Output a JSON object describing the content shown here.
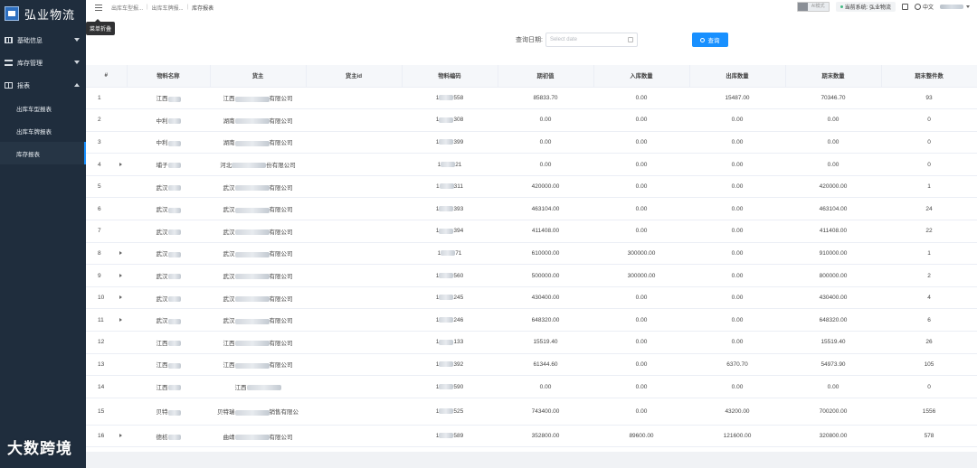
{
  "sidebar": {
    "logo_text": "弘业物流",
    "menu": [
      {
        "label": "基础信息",
        "icon": "table-icon",
        "expanded": false
      },
      {
        "label": "库存管理",
        "icon": "list-icon",
        "expanded": false
      },
      {
        "label": "报表",
        "icon": "report-icon",
        "expanded": true
      }
    ],
    "sub_items": [
      {
        "label": "出库车型报表",
        "active": false
      },
      {
        "label": "出库车牌报表",
        "active": false
      },
      {
        "label": "库存报表",
        "active": true
      }
    ]
  },
  "topbar": {
    "tooltip": "菜单折叠",
    "breadcrumbs": [
      "出库车型报...",
      "出库车牌报...",
      "库存报表"
    ],
    "ai_mode_label": "AI模式",
    "system_badge": "当前系统: 弘业物流",
    "language": "中文"
  },
  "filters": {
    "date_label": "查询日期:",
    "date_placeholder": "Select date",
    "query_button": "查询"
  },
  "table": {
    "headers": [
      "#",
      "物料名称",
      "货主",
      "货主id",
      "物料编码",
      "期初值",
      "入库数量",
      "出库数量",
      "期末数量",
      "期末整件数"
    ],
    "rows": [
      {
        "idx": "1",
        "expand": false,
        "name": "江西",
        "owner_pre": "江西",
        "owner_suf": "有限公司",
        "code_pre": "1",
        "code_suf": "558",
        "opening": "85833.70",
        "inbound": "0.00",
        "outbound": "15487.00",
        "closing": "70346.70",
        "pieces": "93"
      },
      {
        "idx": "2",
        "expand": false,
        "name": "中利",
        "owner_pre": "湖南",
        "owner_suf": "有限公司",
        "code_pre": "1",
        "code_suf": "308",
        "opening": "0.00",
        "inbound": "0.00",
        "outbound": "0.00",
        "closing": "0.00",
        "pieces": "0"
      },
      {
        "idx": "3",
        "expand": false,
        "name": "中利",
        "owner_pre": "湖南",
        "owner_suf": "有限公司",
        "code_pre": "1",
        "code_suf": "399",
        "opening": "0.00",
        "inbound": "0.00",
        "outbound": "0.00",
        "closing": "0.00",
        "pieces": "0"
      },
      {
        "idx": "4",
        "expand": true,
        "name": "埔子",
        "owner_pre": "河北",
        "owner_suf": "份有限公司",
        "code_pre": "1",
        "code_suf": "21",
        "opening": "0.00",
        "inbound": "0.00",
        "outbound": "0.00",
        "closing": "0.00",
        "pieces": "0"
      },
      {
        "idx": "5",
        "expand": false,
        "name": "武汉",
        "owner_pre": "武汉",
        "owner_suf": "有限公司",
        "code_pre": "1",
        "code_suf": "311",
        "opening": "420000.00",
        "inbound": "0.00",
        "outbound": "0.00",
        "closing": "420000.00",
        "pieces": "1"
      },
      {
        "idx": "6",
        "expand": false,
        "name": "武汉",
        "owner_pre": "武汉",
        "owner_suf": "有限公司",
        "code_pre": "1",
        "code_suf": "393",
        "opening": "463104.00",
        "inbound": "0.00",
        "outbound": "0.00",
        "closing": "463104.00",
        "pieces": "24"
      },
      {
        "idx": "7",
        "expand": false,
        "name": "武汉",
        "owner_pre": "武汉",
        "owner_suf": "有限公司",
        "code_pre": "1",
        "code_suf": "394",
        "opening": "411408.00",
        "inbound": "0.00",
        "outbound": "0.00",
        "closing": "411408.00",
        "pieces": "22"
      },
      {
        "idx": "8",
        "expand": true,
        "name": "武汉",
        "owner_pre": "武汉",
        "owner_suf": "有限公司",
        "code_pre": "1",
        "code_suf": "71",
        "opening": "610000.00",
        "inbound": "300000.00",
        "outbound": "0.00",
        "closing": "910000.00",
        "pieces": "1"
      },
      {
        "idx": "9",
        "expand": true,
        "name": "武汉",
        "owner_pre": "武汉",
        "owner_suf": "有限公司",
        "code_pre": "1",
        "code_suf": "560",
        "opening": "500000.00",
        "inbound": "300000.00",
        "outbound": "0.00",
        "closing": "800000.00",
        "pieces": "2"
      },
      {
        "idx": "10",
        "expand": true,
        "name": "武汉",
        "owner_pre": "武汉",
        "owner_suf": "有限公司",
        "code_pre": "1",
        "code_suf": "245",
        "opening": "430400.00",
        "inbound": "0.00",
        "outbound": "0.00",
        "closing": "430400.00",
        "pieces": "4"
      },
      {
        "idx": "11",
        "expand": true,
        "name": "武汉",
        "owner_pre": "武汉",
        "owner_suf": "有限公司",
        "code_pre": "1",
        "code_suf": "246",
        "opening": "648320.00",
        "inbound": "0.00",
        "outbound": "0.00",
        "closing": "648320.00",
        "pieces": "6"
      },
      {
        "idx": "12",
        "expand": false,
        "name": "江西",
        "owner_pre": "江西",
        "owner_suf": "有限公司",
        "code_pre": "1",
        "code_suf": "133",
        "opening": "15519.40",
        "inbound": "0.00",
        "outbound": "0.00",
        "closing": "15519.40",
        "pieces": "26"
      },
      {
        "idx": "13",
        "expand": false,
        "name": "江西",
        "owner_pre": "江西",
        "owner_suf": "有限公司",
        "code_pre": "1",
        "code_suf": "392",
        "opening": "61344.60",
        "inbound": "0.00",
        "outbound": "6370.70",
        "closing": "54973.90",
        "pieces": "105"
      },
      {
        "idx": "14",
        "expand": false,
        "name": "江西",
        "owner_pre": "江西",
        "owner_suf": "",
        "code_pre": "1",
        "code_suf": "590",
        "opening": "0.00",
        "inbound": "0.00",
        "outbound": "0.00",
        "closing": "0.00",
        "pieces": "0"
      },
      {
        "idx": "15",
        "expand": false,
        "name": "贝特",
        "owner_pre": "贝特瑞",
        "owner_suf": "销售有限公",
        "code_pre": "1",
        "code_suf": "525",
        "opening": "743400.00",
        "inbound": "0.00",
        "outbound": "43200.00",
        "closing": "700200.00",
        "pieces": "1556"
      },
      {
        "idx": "16",
        "expand": true,
        "name": "德枋",
        "owner_pre": "曲靖",
        "owner_suf": "有限公司",
        "code_pre": "1",
        "code_suf": "589",
        "opening": "352800.00",
        "inbound": "89600.00",
        "outbound": "121600.00",
        "closing": "320800.00",
        "pieces": "578"
      }
    ]
  },
  "watermark": "大数跨境"
}
